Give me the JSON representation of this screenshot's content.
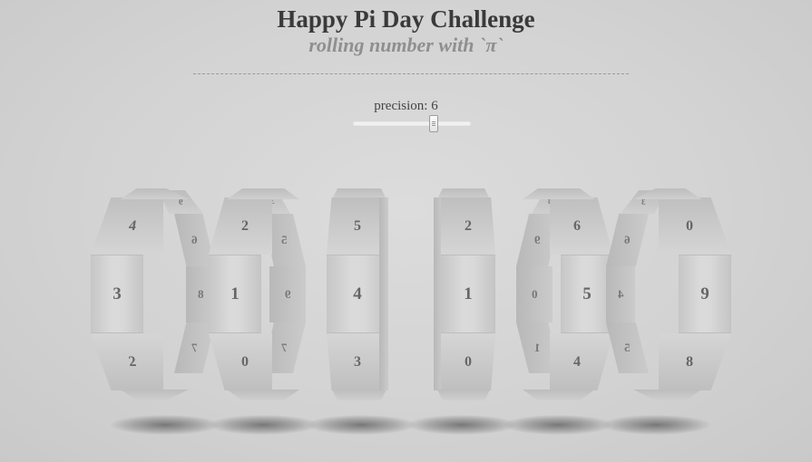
{
  "header": {
    "title": "Happy Pi Day Challenge",
    "subtitle": "rolling number with `π`"
  },
  "control": {
    "label": "precision: 6",
    "precision": 6,
    "range_fraction": 0.65
  },
  "wheels": [
    {
      "top": "4",
      "center": "3",
      "bottom": "2",
      "back_top": "9",
      "back_mid": "8",
      "back_low": "7",
      "back_upper": "6"
    },
    {
      "top": "2",
      "center": "1",
      "bottom": "0",
      "back_top": "3",
      "back_mid": "9",
      "back_low": "7",
      "back_upper": "5"
    },
    {
      "top": "5",
      "center": "4",
      "bottom": "3",
      "back_top": "",
      "back_mid": "",
      "back_low": "",
      "back_upper": ""
    },
    {
      "top": "2",
      "center": "1",
      "bottom": "0",
      "back_top": "",
      "back_mid": "",
      "back_low": "",
      "back_upper": ""
    },
    {
      "top": "6",
      "center": "5",
      "bottom": "4",
      "back_top": "8",
      "back_mid": "0",
      "back_low": "1",
      "back_upper": "9"
    },
    {
      "top": "0",
      "center": "9",
      "bottom": "8",
      "back_top": "3",
      "back_mid": "4",
      "back_low": "5",
      "back_upper": "6"
    }
  ]
}
